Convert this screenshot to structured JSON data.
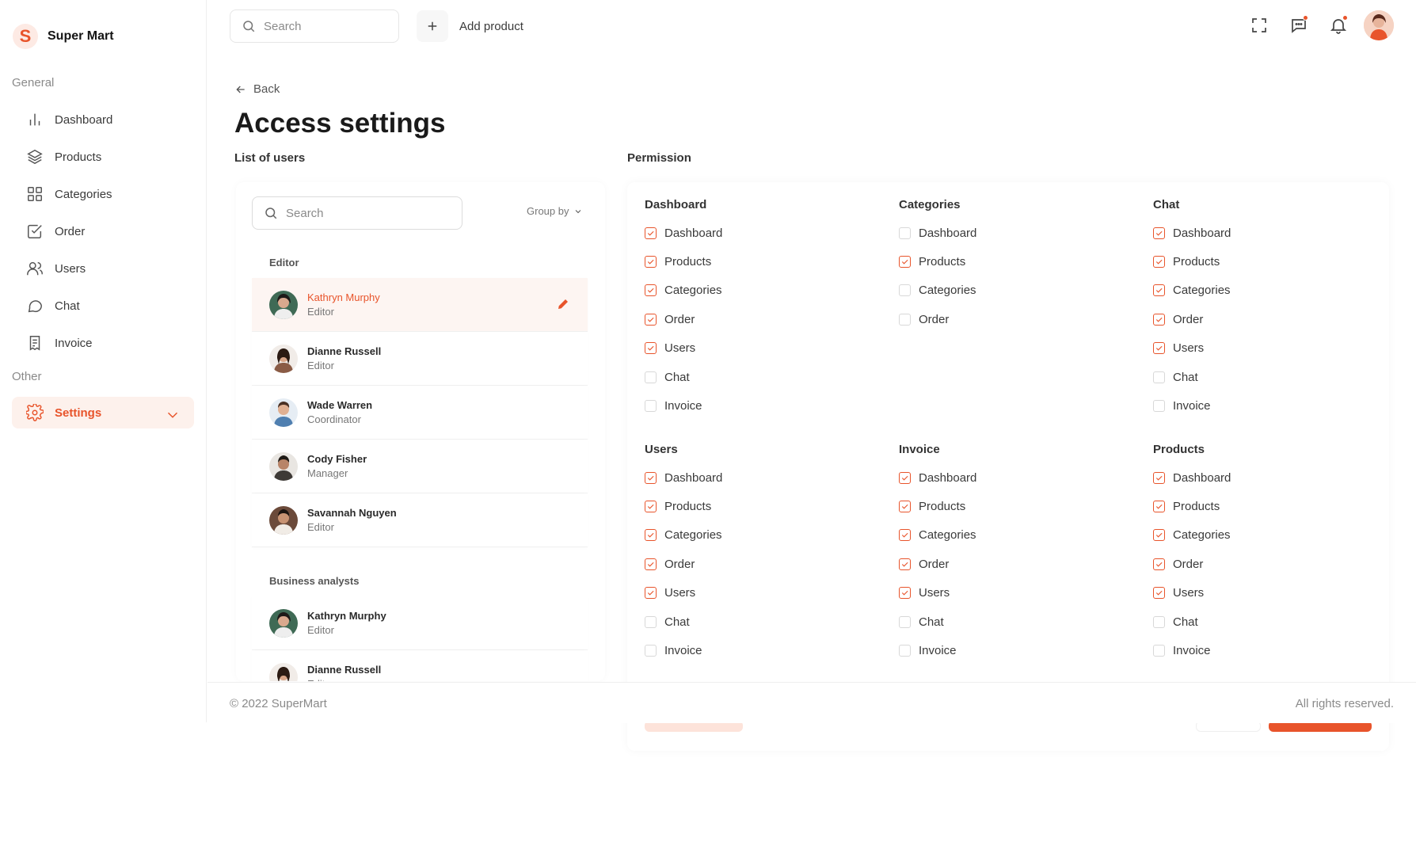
{
  "brand": {
    "logo_letter": "S",
    "name": "Super Mart",
    "accent": "#e8542b"
  },
  "sidebar": {
    "general_label": "General",
    "other_label": "Other",
    "items": [
      {
        "label": "Dashboard",
        "icon": "bar-chart-icon"
      },
      {
        "label": "Products",
        "icon": "layers-icon"
      },
      {
        "label": "Categories",
        "icon": "grid-icon"
      },
      {
        "label": "Order",
        "icon": "checkbox-icon"
      },
      {
        "label": "Users",
        "icon": "users-icon"
      },
      {
        "label": "Chat",
        "icon": "chat-icon"
      },
      {
        "label": "Invoice",
        "icon": "invoice-icon"
      }
    ],
    "settings": {
      "label": "Settings",
      "icon": "gear-icon",
      "active": true
    }
  },
  "topbar": {
    "search_placeholder": "Search",
    "add_product_label": "Add product",
    "icons": [
      "fullscreen-icon",
      "message-icon",
      "bell-icon",
      "avatar"
    ]
  },
  "main": {
    "back_label": "Back",
    "title": "Access settings",
    "users_heading": "List of users",
    "permission_heading": "Permission"
  },
  "users": {
    "search_placeholder": "Search",
    "group_by_label": "Group by",
    "groups": [
      {
        "label": "Editor",
        "members": [
          {
            "name": "Kathryn Murphy",
            "role": "Editor",
            "active": true
          },
          {
            "name": "Dianne Russell",
            "role": "Editor"
          },
          {
            "name": "Wade Warren",
            "role": "Coordinator"
          },
          {
            "name": "Cody Fisher",
            "role": "Manager"
          },
          {
            "name": "Savannah Nguyen",
            "role": "Editor"
          }
        ]
      },
      {
        "label": "Business analysts",
        "members": [
          {
            "name": "Kathryn Murphy",
            "role": "Editor"
          },
          {
            "name": "Dianne Russell",
            "role": "Editor"
          }
        ]
      }
    ]
  },
  "permissions": [
    {
      "title": "Dashboard",
      "items": [
        {
          "label": "Dashboard",
          "checked": true
        },
        {
          "label": "Products",
          "checked": true
        },
        {
          "label": "Categories",
          "checked": true
        },
        {
          "label": "Order",
          "checked": true
        },
        {
          "label": "Users",
          "checked": true
        },
        {
          "label": "Chat",
          "checked": false
        },
        {
          "label": "Invoice",
          "checked": false
        }
      ]
    },
    {
      "title": "Categories",
      "items": [
        {
          "label": "Dashboard",
          "checked": false
        },
        {
          "label": "Products",
          "checked": true
        },
        {
          "label": "Categories",
          "checked": false
        },
        {
          "label": "Order",
          "checked": false
        }
      ]
    },
    {
      "title": "Chat",
      "items": [
        {
          "label": "Dashboard",
          "checked": true
        },
        {
          "label": "Products",
          "checked": true
        },
        {
          "label": "Categories",
          "checked": true
        },
        {
          "label": "Order",
          "checked": true
        },
        {
          "label": "Users",
          "checked": true
        },
        {
          "label": "Chat",
          "checked": false
        },
        {
          "label": "Invoice",
          "checked": false
        }
      ]
    },
    {
      "title": "Users",
      "items": [
        {
          "label": "Dashboard",
          "checked": true
        },
        {
          "label": "Products",
          "checked": true
        },
        {
          "label": "Categories",
          "checked": true
        },
        {
          "label": "Order",
          "checked": true
        },
        {
          "label": "Users",
          "checked": true
        },
        {
          "label": "Chat",
          "checked": false
        },
        {
          "label": "Invoice",
          "checked": false
        }
      ]
    },
    {
      "title": "Invoice",
      "items": [
        {
          "label": "Dashboard",
          "checked": true
        },
        {
          "label": "Products",
          "checked": true
        },
        {
          "label": "Categories",
          "checked": true
        },
        {
          "label": "Order",
          "checked": true
        },
        {
          "label": "Users",
          "checked": true
        },
        {
          "label": "Chat",
          "checked": false
        },
        {
          "label": "Invoice",
          "checked": false
        }
      ]
    },
    {
      "title": "Products",
      "items": [
        {
          "label": "Dashboard",
          "checked": true
        },
        {
          "label": "Products",
          "checked": true
        },
        {
          "label": "Categories",
          "checked": true
        },
        {
          "label": "Order",
          "checked": true
        },
        {
          "label": "Users",
          "checked": true
        },
        {
          "label": "Chat",
          "checked": false
        },
        {
          "label": "Invoice",
          "checked": false
        }
      ]
    }
  ],
  "footer": {
    "copyright": "© 2022 SuperMart",
    "rights": "All rights reserved."
  }
}
